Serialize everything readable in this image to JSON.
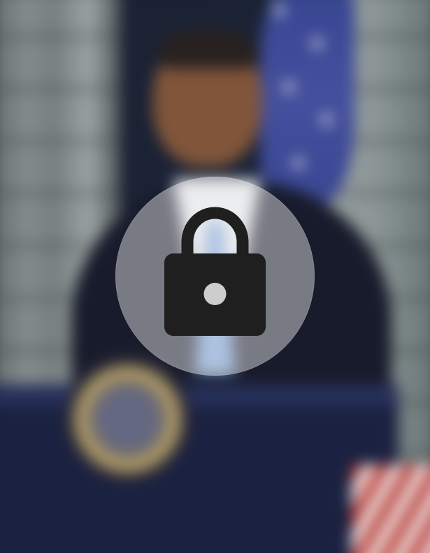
{
  "overlay": {
    "icon": "lock-icon",
    "state": "locked"
  },
  "colors": {
    "lock_fill": "#1f1f1f",
    "badge_fill": "rgba(255,255,255,0.42)"
  }
}
